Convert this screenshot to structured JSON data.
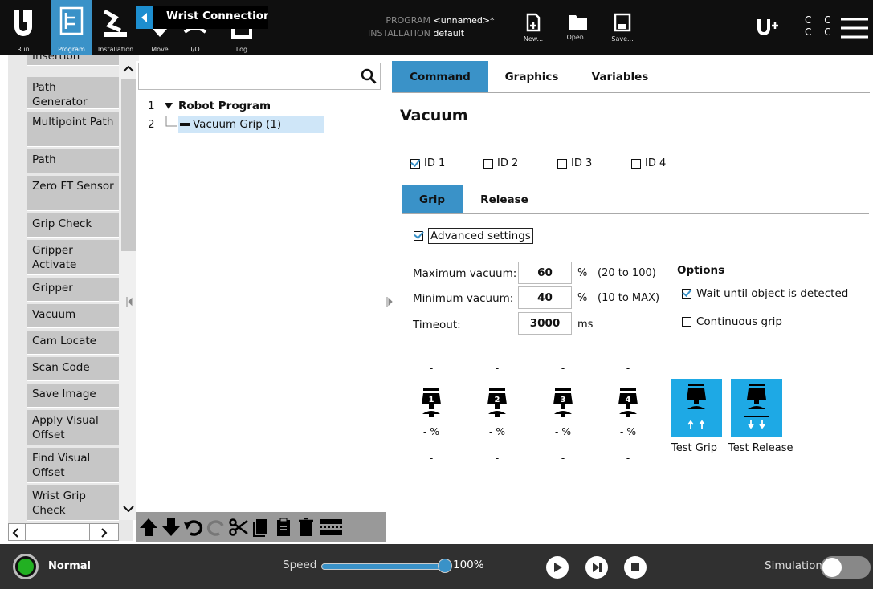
{
  "topbar": {
    "run_label": "Run",
    "program_label": "Program",
    "installation_label": "Installation",
    "move_label": "Move",
    "io_label": "I/O",
    "log_label": "Log",
    "popup_title": "Wrist Connection",
    "program_caption": "PROGRAM",
    "program_value": "<unnamed>*",
    "installation_caption": "INSTALLATION",
    "installation_value": "default",
    "new_label": "New...",
    "open_label": "Open...",
    "save_label": "Save...",
    "cc_row1": "C C",
    "cc_row2": "C C"
  },
  "nodes": {
    "items": [
      {
        "label": "Insertion"
      },
      {
        "label": "Path Generator"
      },
      {
        "label": "Multipoint Path"
      },
      {
        "label": "Path"
      },
      {
        "label": "Zero FT Sensor"
      },
      {
        "label": "Grip Check"
      },
      {
        "label": "Gripper Activate"
      },
      {
        "label": "Gripper"
      },
      {
        "label": "Vacuum"
      },
      {
        "label": "Cam Locate"
      },
      {
        "label": "Scan Code"
      },
      {
        "label": "Save Image"
      },
      {
        "label": "Apply Visual Offset"
      },
      {
        "label": "Find Visual Offset"
      },
      {
        "label": "Wrist Grip Check"
      }
    ]
  },
  "tree": {
    "search_placeholder": "",
    "rows": [
      {
        "num": "1",
        "label": "Robot Program"
      },
      {
        "num": "2",
        "label": "Vacuum Grip  (1)"
      }
    ]
  },
  "tabs": {
    "command": "Command",
    "graphics": "Graphics",
    "variables": "Variables"
  },
  "vacuum": {
    "title": "Vacuum",
    "ids": [
      "ID 1",
      "ID 2",
      "ID 3",
      "ID 4"
    ],
    "ids_checked": [
      true,
      false,
      false,
      false
    ],
    "subtabs": {
      "grip": "Grip",
      "release": "Release"
    },
    "advanced_label": "Advanced settings",
    "max_label": "Maximum vacuum:",
    "max_value": "60",
    "max_unit": "%",
    "max_range": "(20 to 100)",
    "min_label": "Minimum vacuum:",
    "min_value": "40",
    "min_unit": "%",
    "min_range": "(10 to MAX)",
    "timeout_label": "Timeout:",
    "timeout_value": "3000",
    "timeout_unit": "ms",
    "options_title": "Options",
    "opt_wait": "Wait until object is detected",
    "opt_wait_checked": true,
    "opt_continuous": "Continuous grip",
    "opt_continuous_checked": false,
    "indicators": [
      {
        "id": "1",
        "top": "-",
        "pct": "- %",
        "bottom": "-"
      },
      {
        "id": "2",
        "top": "-",
        "pct": "- %",
        "bottom": "-"
      },
      {
        "id": "3",
        "top": "-",
        "pct": "- %",
        "bottom": "-"
      },
      {
        "id": "4",
        "top": "-",
        "pct": "- %",
        "bottom": "-"
      }
    ],
    "test_grip": "Test Grip",
    "test_release": "Test Release"
  },
  "bottombar": {
    "status": "Normal",
    "speed_label": "Speed",
    "speed_value": "100%",
    "simulation_label": "Simulation",
    "accent": "#3a92c8"
  }
}
